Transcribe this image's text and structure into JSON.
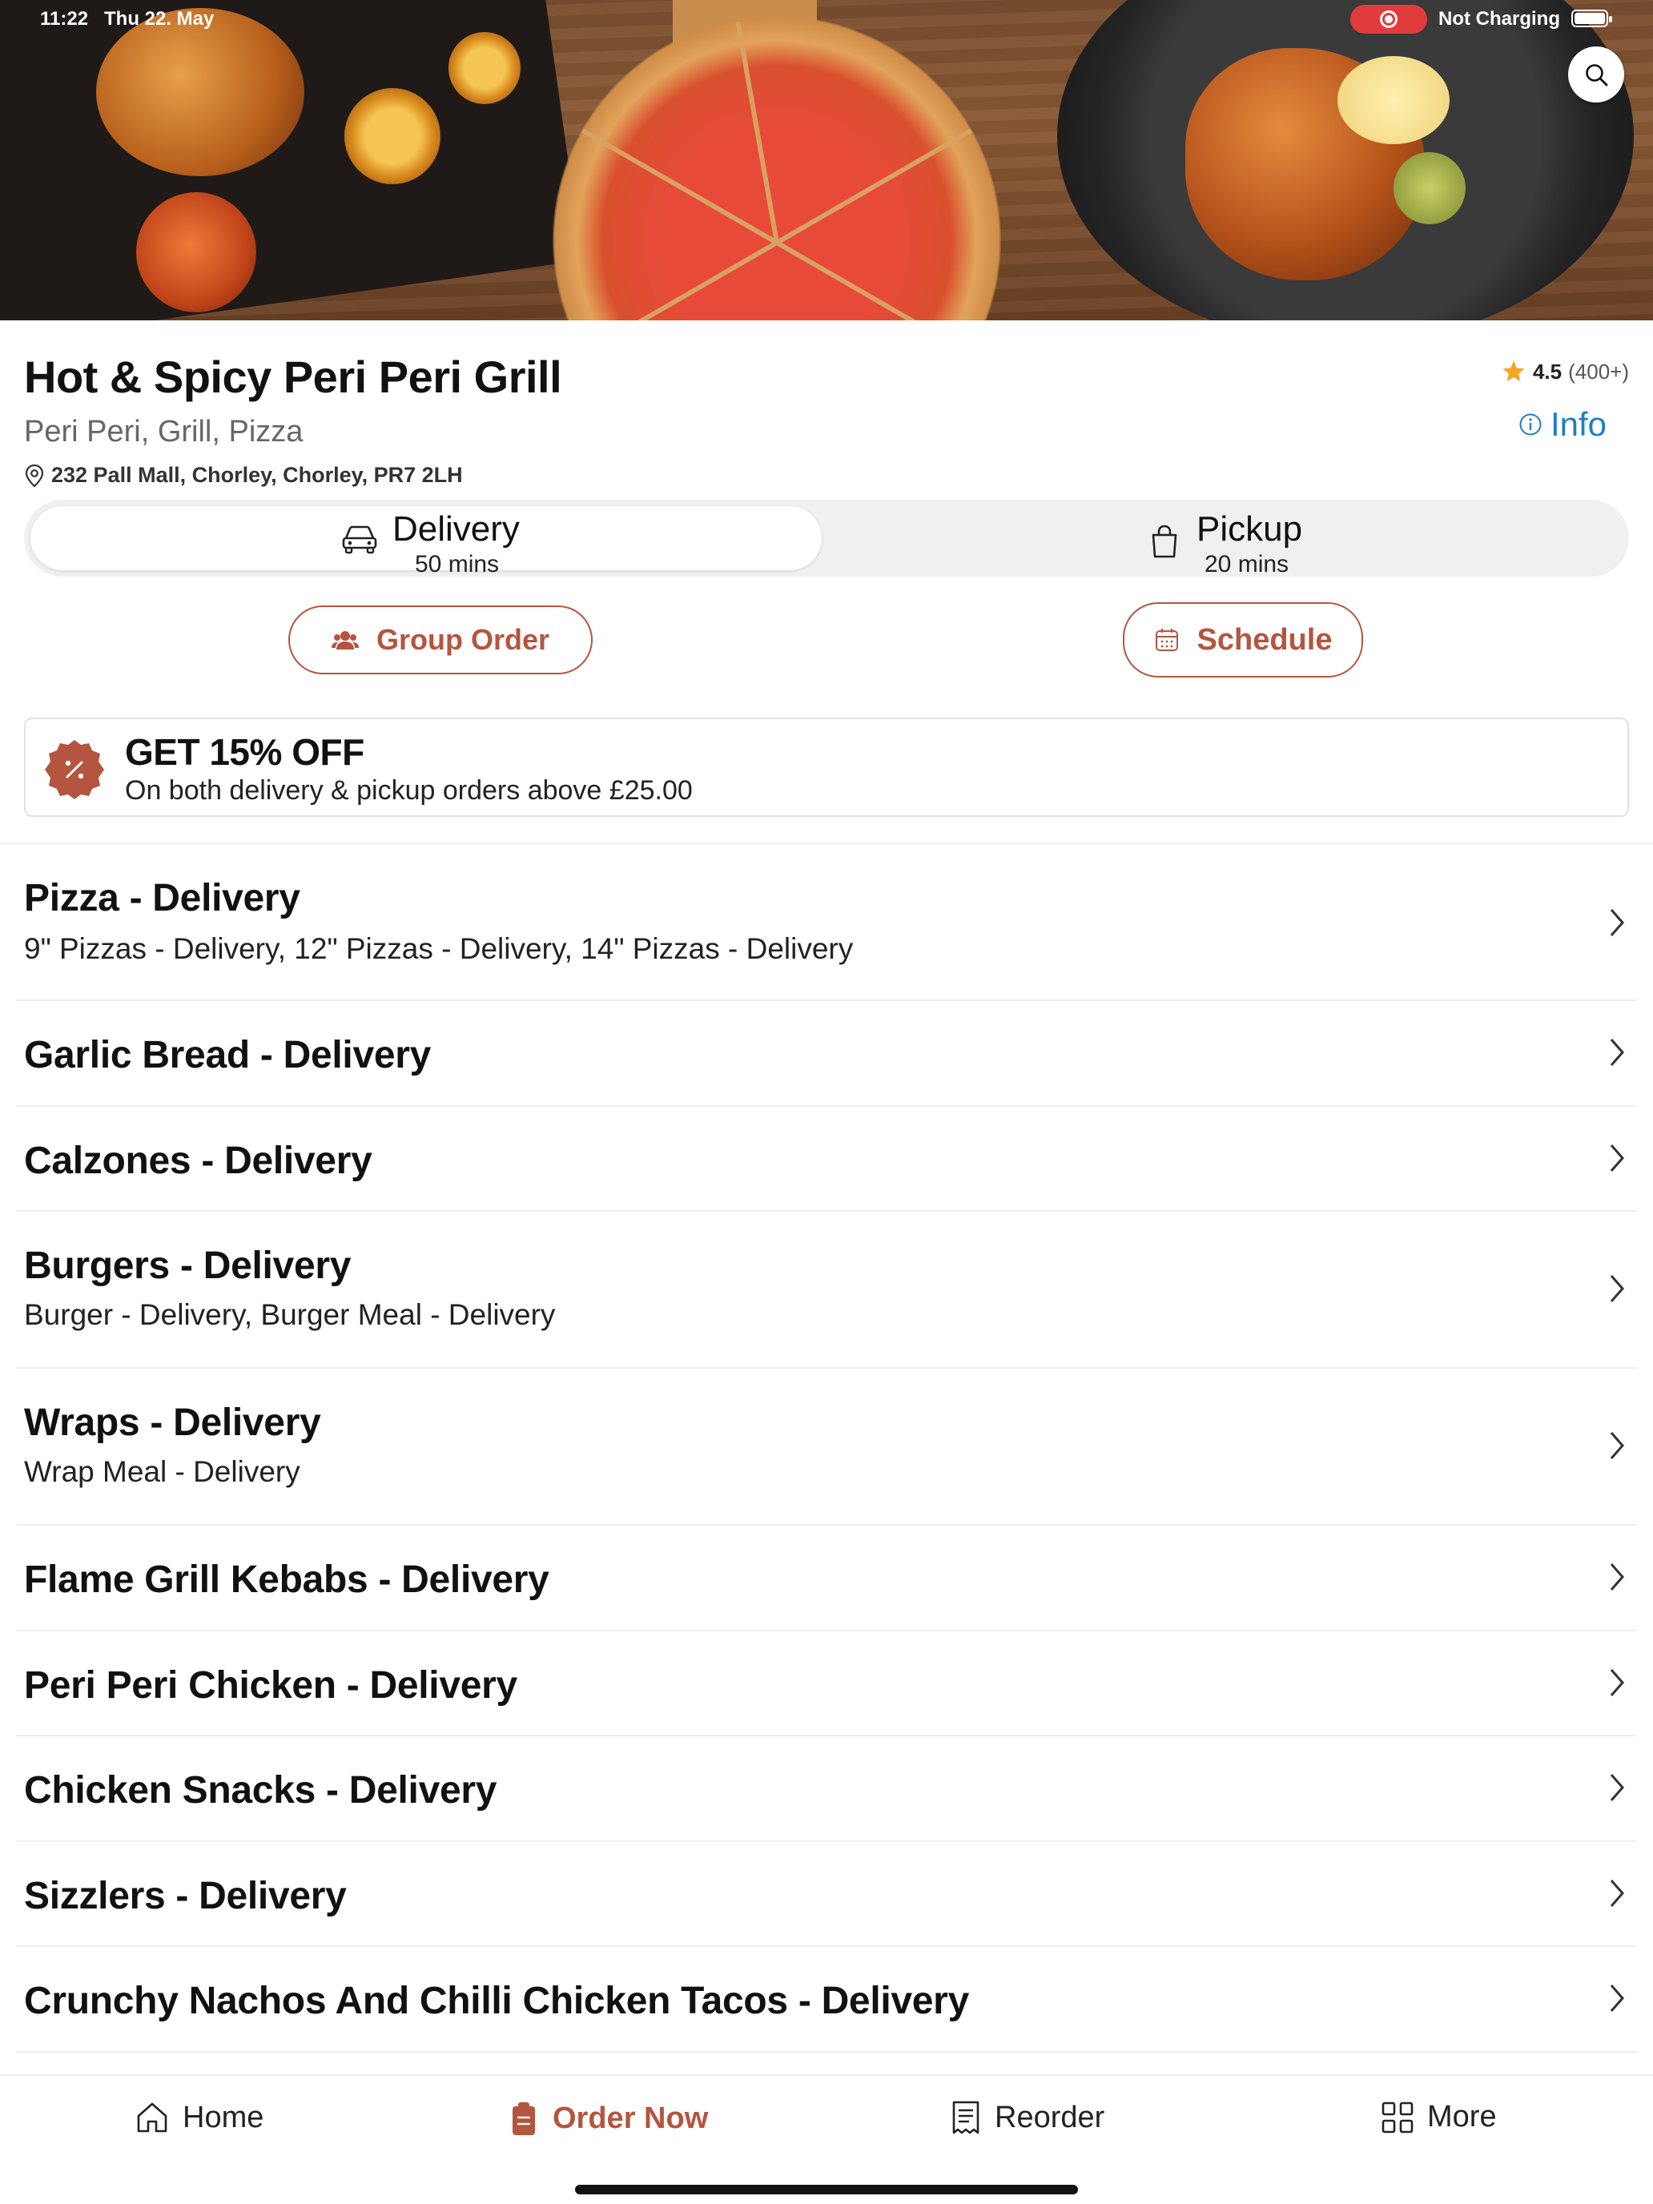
{
  "status_bar": {
    "time": "11:22",
    "date": "Thu 22. May",
    "charging": "Not Charging"
  },
  "restaurant": {
    "name": "Hot & Spicy Peri Peri Grill",
    "cuisine": "Peri Peri, Grill, Pizza",
    "address": "232 Pall Mall, Chorley, Chorley, PR7 2LH",
    "rating": "4.5",
    "rating_count": "(400+)",
    "info_label": "Info"
  },
  "mode_toggle": {
    "delivery_label": "Delivery",
    "delivery_time": "50 mins",
    "pickup_label": "Pickup",
    "pickup_time": "20 mins",
    "selected": "Delivery"
  },
  "actions": {
    "group_order": "Group Order",
    "schedule": "Schedule"
  },
  "promo": {
    "title": "GET 15% OFF",
    "subtitle": "On both delivery & pickup orders above £25.00"
  },
  "categories": [
    {
      "title": "Pizza - Delivery",
      "subtitle": "9\" Pizzas - Delivery, 12\" Pizzas - Delivery, 14\" Pizzas - Delivery"
    },
    {
      "title": "Garlic Bread - Delivery",
      "subtitle": ""
    },
    {
      "title": "Calzones - Delivery",
      "subtitle": ""
    },
    {
      "title": "Burgers - Delivery",
      "subtitle": "Burger - Delivery, Burger Meal - Delivery"
    },
    {
      "title": "Wraps - Delivery",
      "subtitle": "Wrap Meal - Delivery"
    },
    {
      "title": "Flame Grill Kebabs - Delivery",
      "subtitle": ""
    },
    {
      "title": "Peri Peri Chicken - Delivery",
      "subtitle": ""
    },
    {
      "title": "Chicken Snacks - Delivery",
      "subtitle": ""
    },
    {
      "title": "Sizzlers - Delivery",
      "subtitle": ""
    },
    {
      "title": "Crunchy Nachos And Chilli Chicken Tacos - Delivery",
      "subtitle": ""
    }
  ],
  "bottom_nav": {
    "home": "Home",
    "order_now": "Order Now",
    "reorder": "Reorder",
    "more": "More",
    "active": "Order Now"
  },
  "colors": {
    "accent": "#b4553f",
    "link": "#1f7fc0",
    "star": "#f5a623",
    "recording": "#e23b3b"
  }
}
